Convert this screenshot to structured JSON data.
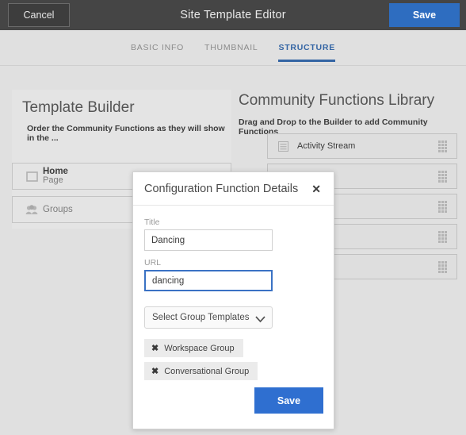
{
  "topbar": {
    "cancel_label": "Cancel",
    "title": "Site Template Editor",
    "save_label": "Save",
    "background": "#454545",
    "save_color": "#2e6dc0"
  },
  "tabs": [
    {
      "label": "BASIC INFO",
      "active": false
    },
    {
      "label": "THUMBNAIL",
      "active": false
    },
    {
      "label": "STRUCTURE",
      "active": true
    }
  ],
  "tab_active_color": "#3465a4",
  "builder_panel": {
    "title": "Template Builder",
    "subtitle": "Order the Community Functions as they will show in the ...",
    "rows": [
      {
        "name": "Home",
        "kind": "Page",
        "icon": "page-icon"
      },
      {
        "name": "Groups",
        "kind": "",
        "icon": "groups-icon"
      }
    ]
  },
  "library_panel": {
    "title": "Community Functions Library",
    "subtitle": "Drag and Drop to the Builder to add Community Functions",
    "rows": [
      {
        "label": "Activity Stream",
        "icon": "list-icon"
      },
      {
        "label": "",
        "icon": ""
      },
      {
        "label": "",
        "icon": ""
      },
      {
        "label": "",
        "icon": ""
      },
      {
        "label": "",
        "icon": ""
      }
    ]
  },
  "modal": {
    "title": "Configuration Function Details",
    "close_label": "✕",
    "fields": {
      "title_label": "Title",
      "title_value": "Dancing",
      "title_placeholder": "Title",
      "url_label": "URL",
      "url_value": "dancing",
      "url_placeholder": "URL"
    },
    "select": {
      "value": "Select Group Templates",
      "caret": "⌄"
    },
    "chips": [
      {
        "label": "Workspace Group",
        "remove": "✖"
      },
      {
        "label": "Conversational Group",
        "remove": "✖"
      }
    ],
    "save_label": "Save",
    "save_color": "#2f6fd0",
    "focus_color": "#3a72c4"
  }
}
